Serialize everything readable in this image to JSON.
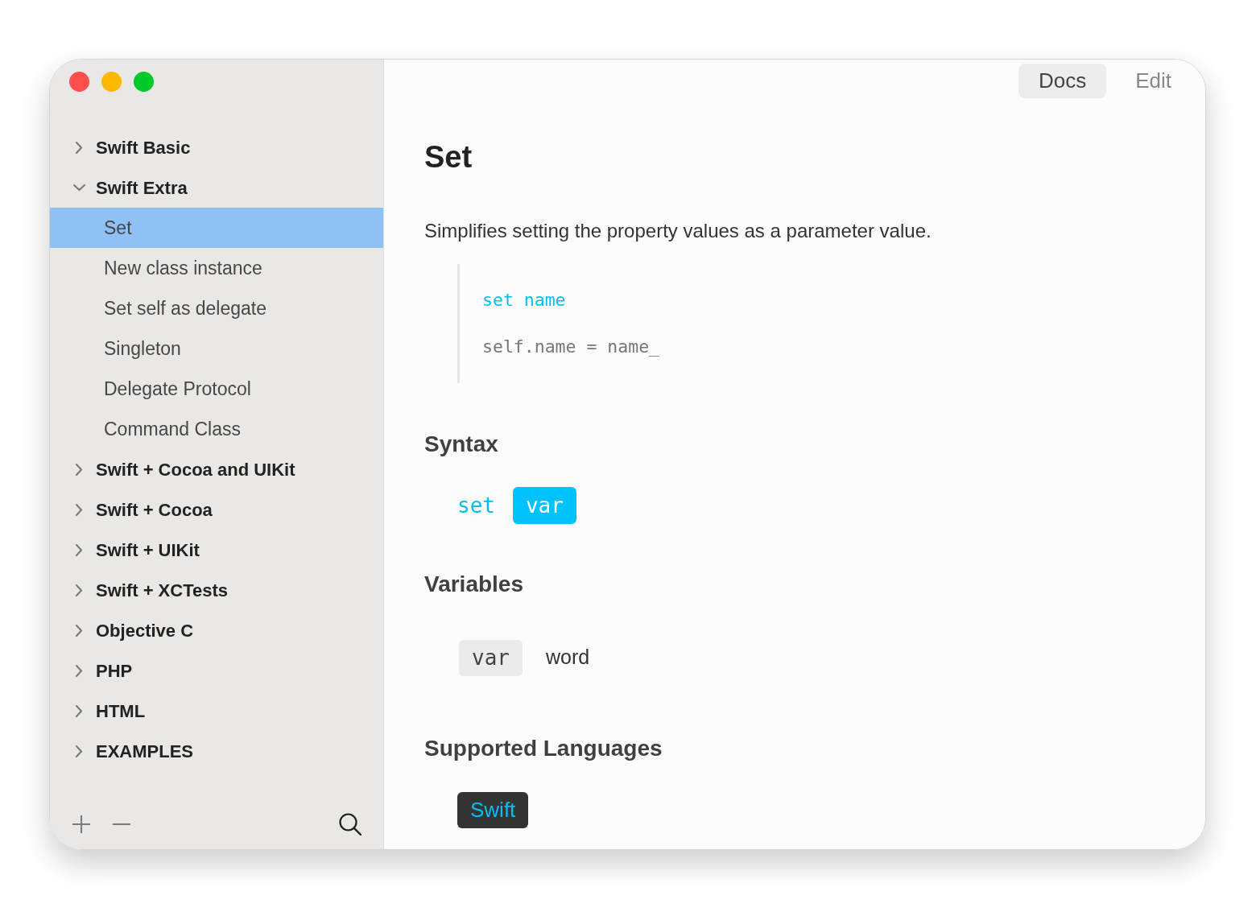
{
  "sidebar": {
    "items": [
      {
        "label": "Swift Basic",
        "expanded": false,
        "selected": false
      },
      {
        "label": "Swift Extra",
        "expanded": true,
        "selected": false,
        "children": [
          {
            "label": "Set",
            "selected": true
          },
          {
            "label": "New class instance",
            "selected": false
          },
          {
            "label": "Set self as delegate",
            "selected": false
          },
          {
            "label": "Singleton",
            "selected": false
          },
          {
            "label": "Delegate Protocol",
            "selected": false
          },
          {
            "label": "Command Class",
            "selected": false
          }
        ]
      },
      {
        "label": "Swift + Cocoa and UIKit",
        "expanded": false,
        "selected": false
      },
      {
        "label": "Swift + Cocoa",
        "expanded": false,
        "selected": false
      },
      {
        "label": "Swift + UIKit",
        "expanded": false,
        "selected": false
      },
      {
        "label": "Swift + XCTests",
        "expanded": false,
        "selected": false
      },
      {
        "label": "Objective C",
        "expanded": false,
        "selected": false
      },
      {
        "label": "PHP",
        "expanded": false,
        "selected": false
      },
      {
        "label": "HTML",
        "expanded": false,
        "selected": false
      },
      {
        "label": "EXAMPLES",
        "expanded": false,
        "selected": false
      }
    ]
  },
  "tabs": [
    {
      "label": "Docs",
      "selected": true
    },
    {
      "label": "Edit",
      "selected": false
    }
  ],
  "document": {
    "title": "Set",
    "description": "Simplifies setting the property values as a parameter value.",
    "snippet": [
      {
        "kind": "keyword",
        "text": "set name"
      },
      {
        "kind": "code",
        "text": "self.name = name_"
      }
    ],
    "sections": [
      {
        "kind": "syntax",
        "heading": "Syntax",
        "tokens": [
          {
            "kind": "keyword",
            "text": "set"
          },
          {
            "kind": "placeholder",
            "text": "var"
          }
        ]
      },
      {
        "kind": "variables",
        "heading": "Variables",
        "variables": [
          {
            "name": "var",
            "description": "word"
          }
        ]
      },
      {
        "kind": "languages",
        "heading": "Supported Languages",
        "languages": [
          "Swift"
        ]
      }
    ]
  }
}
